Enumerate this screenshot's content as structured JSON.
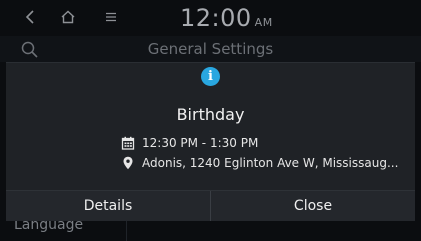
{
  "status_bar": {
    "back_icon": "chevron-left-icon",
    "home_icon": "home-icon",
    "menu_icon": "menu-icon",
    "time": "12:00",
    "ampm": "AM"
  },
  "background": {
    "search_icon": "search-icon",
    "title": "General Settings",
    "list_item": "Language"
  },
  "popup": {
    "icon": "info-icon",
    "title": "Birthday",
    "time_range": "12:30 PM - 1:30 PM",
    "location": "Adonis, 1240 Eglinton Ave W, Mississaug...",
    "buttons": {
      "details": "Details",
      "close": "Close"
    }
  },
  "colors": {
    "info_accent": "#29a7e0",
    "popup_bg": "#1f2226"
  }
}
